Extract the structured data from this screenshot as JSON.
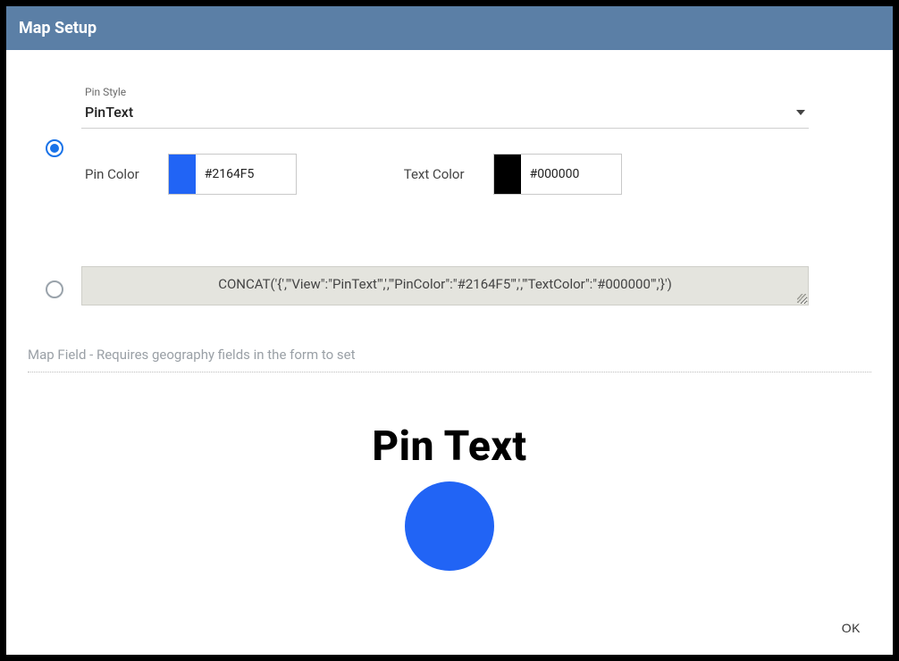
{
  "dialog": {
    "title": "Map Setup",
    "ok_label": "OK"
  },
  "pinStyle": {
    "label": "Pin Style",
    "value": "PinText"
  },
  "pinColor": {
    "label": "Pin Color",
    "hex": "#2164F5"
  },
  "textColor": {
    "label": "Text Color",
    "hex": "#000000"
  },
  "expression": {
    "value": "CONCAT('{',\"'View\":\"PinText\"',',\"'PinColor\":\"#2164F5\"',',\"'TextColor\":\"#000000\"','}')"
  },
  "mapField": {
    "note": "Map Field - Requires geography fields in the form to set"
  },
  "preview": {
    "title": "Pin Text"
  },
  "option_mode": "builder"
}
